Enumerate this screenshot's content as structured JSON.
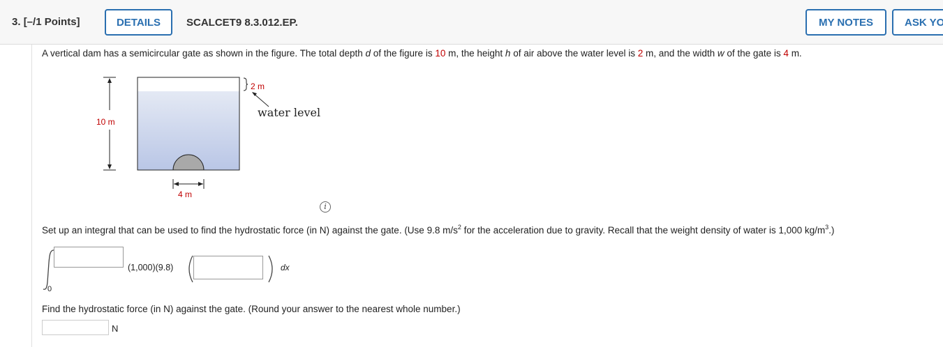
{
  "header": {
    "question_number": "3.",
    "points": "[–/1 Points]",
    "details_label": "DETAILS",
    "problem_code": "SCALCET9 8.3.012.EP.",
    "my_notes_label": "MY NOTES",
    "ask_label": "ASK YO"
  },
  "problem": {
    "parts": [
      "A vertical dam has a semicircular gate as shown in the figure. The total depth ",
      "d",
      " of the figure is ",
      "10",
      " m, the height ",
      "h",
      " of air above the water level is ",
      "2",
      " m, and the width ",
      "w",
      " of the gate is ",
      "4",
      " m."
    ]
  },
  "figure": {
    "depth_label": "10 m",
    "air_label": "2 m",
    "water_level_label": "water level",
    "width_label": "4 m",
    "accent_color": "#c00000"
  },
  "info_icon": "i",
  "setup": {
    "text_before": "Set up an integral that can be used to find the hydrostatic force (in N) against the gate. (Use 9.8 m/s",
    "sup1": "2",
    "text_middle": " for the acceleration due to gravity. Recall that the weight density of water is 1,000 kg/m",
    "sup2": "3",
    "text_after": ".)",
    "lower_limit": "0",
    "constant": "(1,000)(9.8)",
    "dx": "dx",
    "upper_input_value": "",
    "integrand_input_value": ""
  },
  "find": {
    "text": "Find the hydrostatic force (in N) against the gate. (Round your answer to the nearest whole number.)",
    "answer_value": "",
    "unit": "N"
  },
  "colors": {
    "link_blue": "#2a6fb0",
    "red": "#c00000"
  }
}
